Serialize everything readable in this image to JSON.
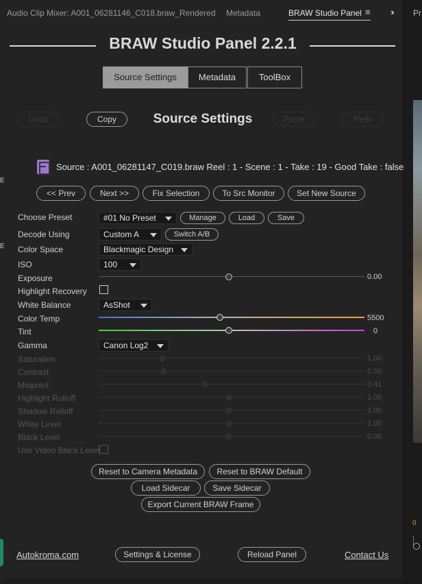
{
  "tabs": {
    "audio_clip_mixer": "Audio Clip Mixer: A001_06281146_C018.braw_Rendered",
    "metadata": "Metadata",
    "braw_studio": "BRAW Studio Panel",
    "menu_icon": "hamburger-menu-icon",
    "expand_icon": "double-chevron-right-icon"
  },
  "neighbor_panel": {
    "title_fragment": "Pr",
    "readout_fragment": "0"
  },
  "panel": {
    "title": "BRAW Studio Panel 2.2.1",
    "segments": [
      "Source Settings",
      "Metadata",
      "ToolBox"
    ],
    "active_segment": "Source Settings",
    "undo": "Undo",
    "copy": "Copy",
    "section_title": "Source Settings",
    "paste": "Paste",
    "redo": "Redo",
    "source_icon": "film-clip-icon",
    "source_line": "Source : A001_06281147_C019.braw  Reel : 1 - Scene : 1 - Take : 19 - Good Take : false",
    "nav": {
      "prev": "<< Prev",
      "next": "Next >>",
      "fix_selection": "Fix Selection",
      "to_src_monitor": "To Src Monitor",
      "set_new_source": "Set New Source"
    },
    "settings": {
      "choose_preset": {
        "label": "Choose Preset",
        "value": "#01 No Preset",
        "manage": "Manage",
        "load": "Load",
        "save": "Save"
      },
      "decode_using": {
        "label": "Decode Using",
        "value": "Custom A",
        "switch": "Switch A/B"
      },
      "color_space": {
        "label": "Color Space",
        "value": "Blackmagic Design"
      },
      "iso": {
        "label": "ISO",
        "value": "100"
      },
      "exposure": {
        "label": "Exposure",
        "value": "0.00",
        "fraction": 0.49
      },
      "highlight_recovery": {
        "label": "Highlight Recovery",
        "checked": false
      },
      "white_balance": {
        "label": "White Balance",
        "value": "AsShot"
      },
      "color_temp": {
        "label": "Color Temp",
        "value": "5500",
        "fraction": 0.455
      },
      "tint": {
        "label": "Tint",
        "value": "0",
        "fraction": 0.49
      },
      "gamma": {
        "label": "Gamma",
        "value": "Canon Log2"
      },
      "saturation": {
        "label": "Saturation",
        "value": "1.00",
        "fraction": 0.24
      },
      "contrast": {
        "label": "Contrast",
        "value": "0.50",
        "fraction": 0.245
      },
      "midpoint": {
        "label": "Midpoint",
        "value": "0.41",
        "fraction": 0.4
      },
      "highlight_rolloff": {
        "label": "Highlight Rolloff",
        "value": "1.00",
        "fraction": 0.49
      },
      "shadow_rolloff": {
        "label": "Shadow Rolloff",
        "value": "1.00",
        "fraction": 0.49
      },
      "white_level": {
        "label": "White Level",
        "value": "1.00",
        "fraction": 0.49
      },
      "black_level": {
        "label": "Black Level",
        "value": "0.00",
        "fraction": 0.49
      },
      "use_video_black_level": {
        "label": "Use Video Black Level",
        "checked": false
      }
    },
    "actions": {
      "reset_camera": "Reset to Camera Metadata",
      "reset_braw": "Reset to BRAW Default",
      "load_sidecar": "Load Sidecar",
      "save_sidecar": "Save Sidecar",
      "export_frame": "Export Current BRAW Frame"
    },
    "footer": {
      "autokroma": "Autokroma.com",
      "settings_license": "Settings & License",
      "reload": "Reload Panel",
      "contact": "Contact Us"
    }
  }
}
